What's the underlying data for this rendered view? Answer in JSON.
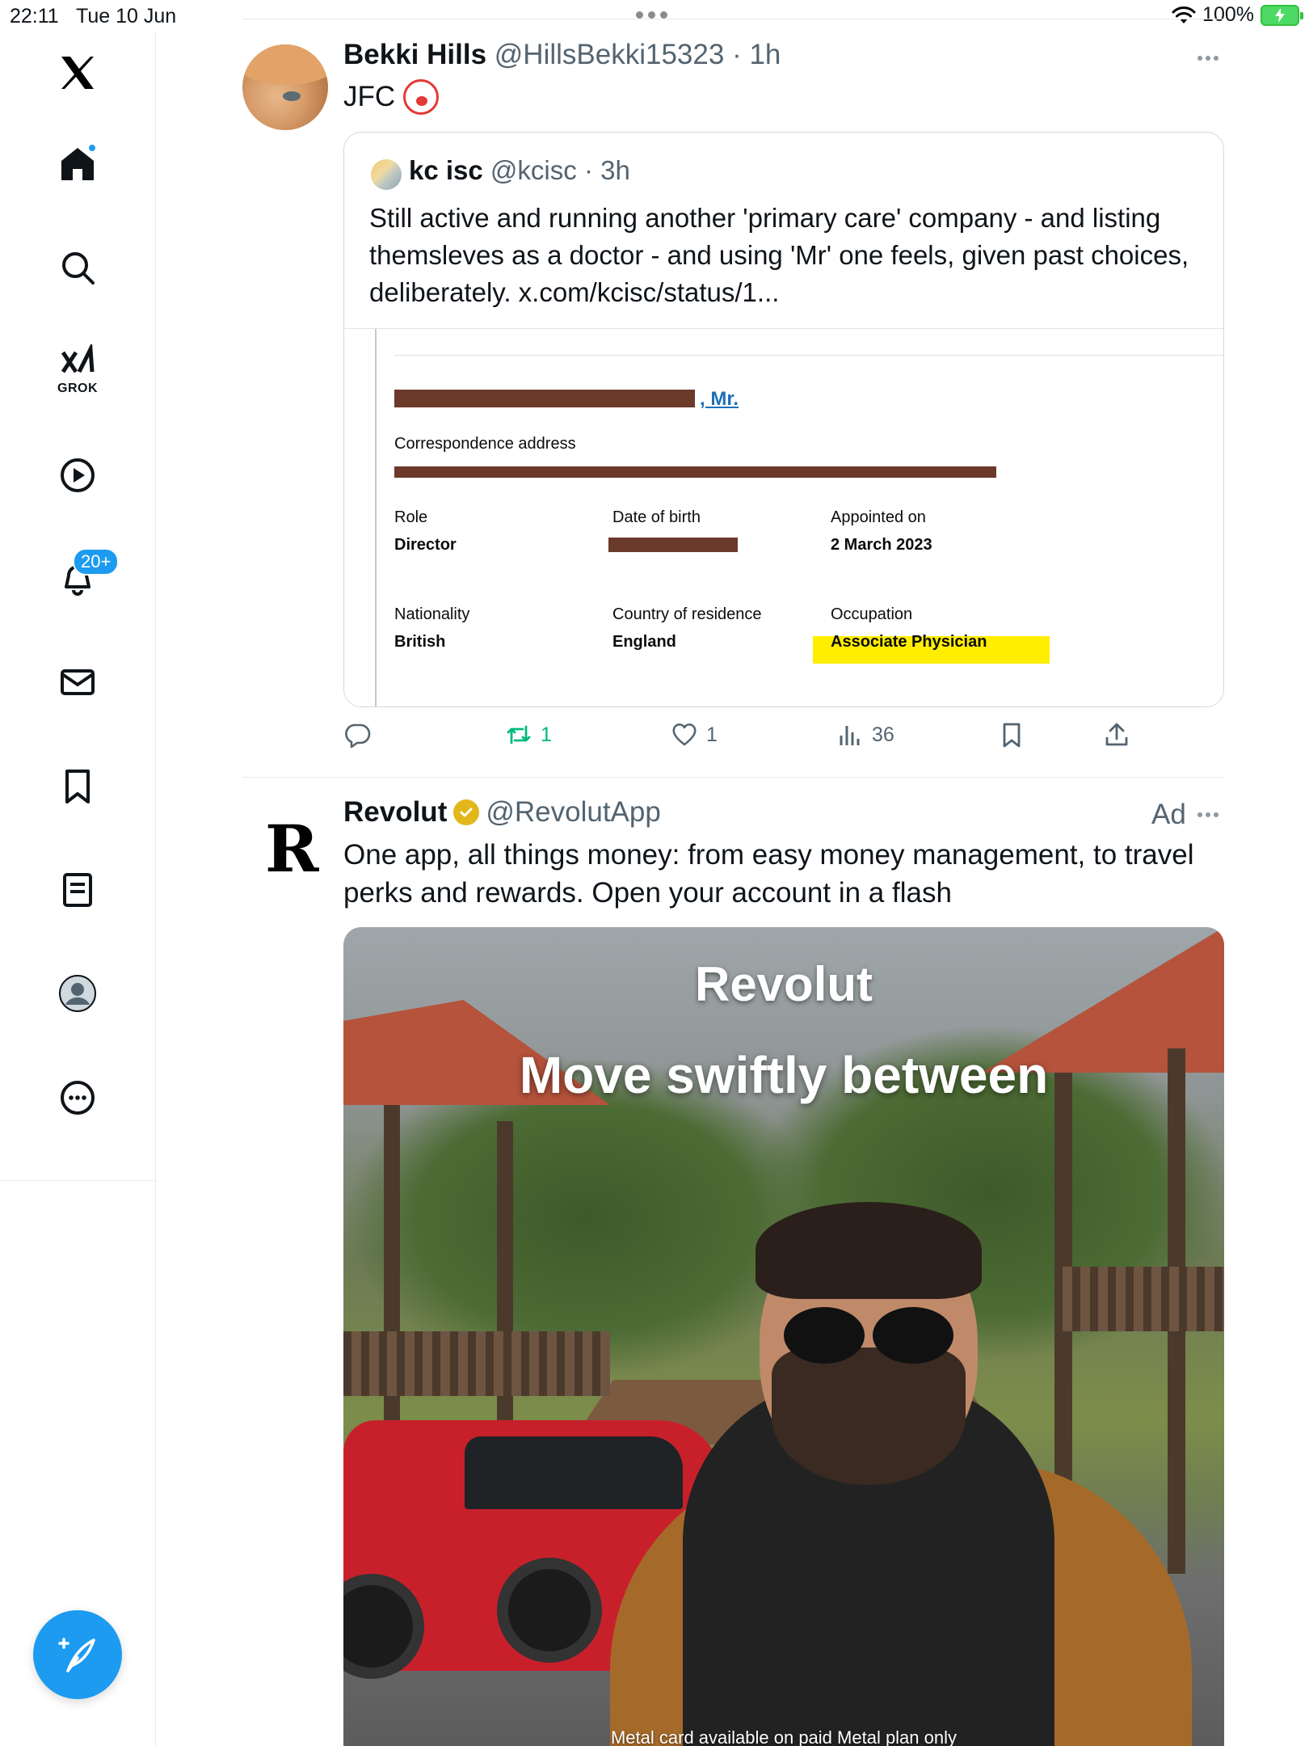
{
  "status_bar": {
    "time": "22:11",
    "date": "Tue 10 Jun",
    "battery": "100%"
  },
  "sidebar": {
    "items": [
      {
        "icon": "x-logo-icon"
      },
      {
        "icon": "home-icon",
        "has_dot": true
      },
      {
        "icon": "search-icon"
      },
      {
        "icon": "grok-icon",
        "label": "GROK"
      },
      {
        "icon": "video-play-icon"
      },
      {
        "icon": "bell-icon",
        "badge": "20+"
      },
      {
        "icon": "mail-icon"
      },
      {
        "icon": "bookmark-icon"
      },
      {
        "icon": "lists-icon"
      },
      {
        "icon": "profile-icon"
      },
      {
        "icon": "more-icon"
      }
    ],
    "compose_icon": "compose-icon"
  },
  "tweet1": {
    "name": "Bekki Hills",
    "handle": "@HillsBekki15323",
    "time": "1h",
    "text": "JFC",
    "emoji": "clown-emoji",
    "quote": {
      "name": "kc isc",
      "handle": "@kcisc",
      "time": "3h",
      "text": "Still active and running another 'primary care' company - and listing themsleves as a doctor - and using 'Mr' one feels, given past choices, deliberately. x.com/kcisc/status/1...",
      "document": {
        "name_suffix": ", Mr.",
        "correspondence_label": "Correspondence address",
        "role_label": "Role",
        "role_value": "Director",
        "dob_label": "Date of birth",
        "appointed_label": "Appointed on",
        "appointed_value": "2 March 2023",
        "nationality_label": "Nationality",
        "nationality_value": "British",
        "residence_label": "Country of residence",
        "residence_value": "England",
        "occupation_label": "Occupation",
        "occupation_value": "Associate Physician"
      }
    },
    "actions": {
      "reply": "",
      "retweets": "1",
      "likes": "1",
      "views": "36"
    }
  },
  "tweet2": {
    "name": "Revolut",
    "handle": "@RevolutApp",
    "ad_label": "Ad",
    "text": "One app, all things money: from easy money management, to travel perks and rewards. Open your account in a flash",
    "media": {
      "brand": "Revolut",
      "headline": "Move swiftly between",
      "disclaimer": "Metal card available on paid Metal plan only"
    }
  },
  "colors": {
    "accent": "#1d9bf0",
    "retweet_green": "#00ba7c",
    "verified_gold": "#e2b719",
    "highlight_yellow": "#ffee00",
    "redaction_brown": "#6b3a2a"
  }
}
